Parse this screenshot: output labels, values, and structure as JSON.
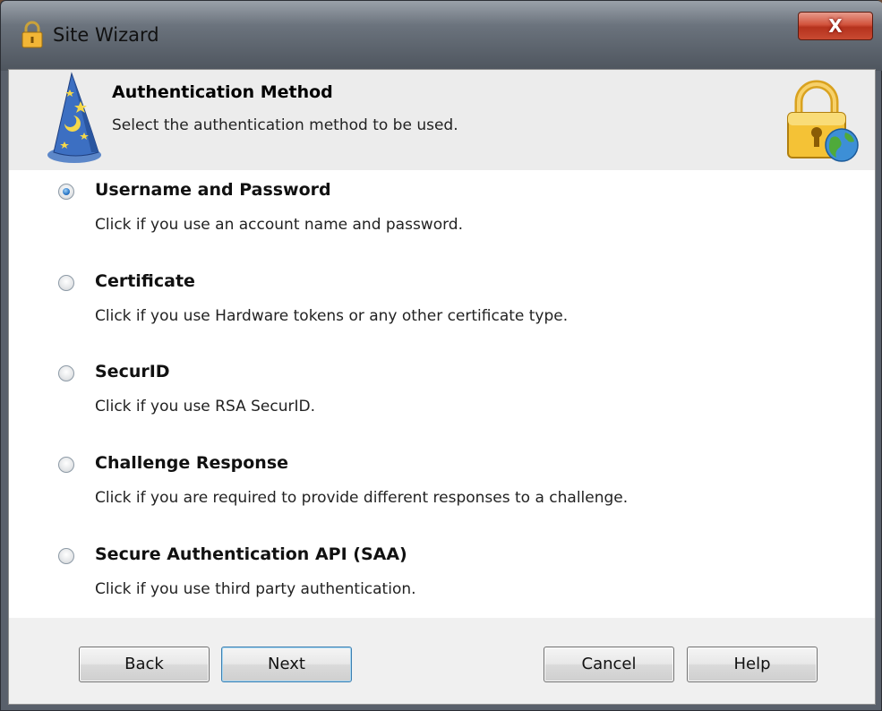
{
  "window": {
    "title": "Site Wizard",
    "close_glyph": "X"
  },
  "header": {
    "title": "Authentication Method",
    "subtitle": "Select the authentication method to be used."
  },
  "options": [
    {
      "label": "Username and Password",
      "description": "Click if you use an account name and password.",
      "selected": true
    },
    {
      "label": "Certificate",
      "description": "Click if you use Hardware tokens or any other certificate type.",
      "selected": false
    },
    {
      "label": "SecurID",
      "description": "Click if you use RSA SecurID.",
      "selected": false
    },
    {
      "label": "Challenge Response",
      "description": "Click if you are required to provide different responses to a challenge.",
      "selected": false
    },
    {
      "label": "Secure Authentication API (SAA)",
      "description": "Click if you use third party authentication.",
      "selected": false
    }
  ],
  "buttons": {
    "back": "Back",
    "next": "Next",
    "cancel": "Cancel",
    "help": "Help"
  },
  "colors": {
    "accent_radio": "#2a77c7",
    "close_button": "#c84a32"
  },
  "icons": [
    "padlock-app-icon",
    "close-icon",
    "wizard-hat-icon",
    "lock-globe-icon",
    "radio-button"
  ]
}
